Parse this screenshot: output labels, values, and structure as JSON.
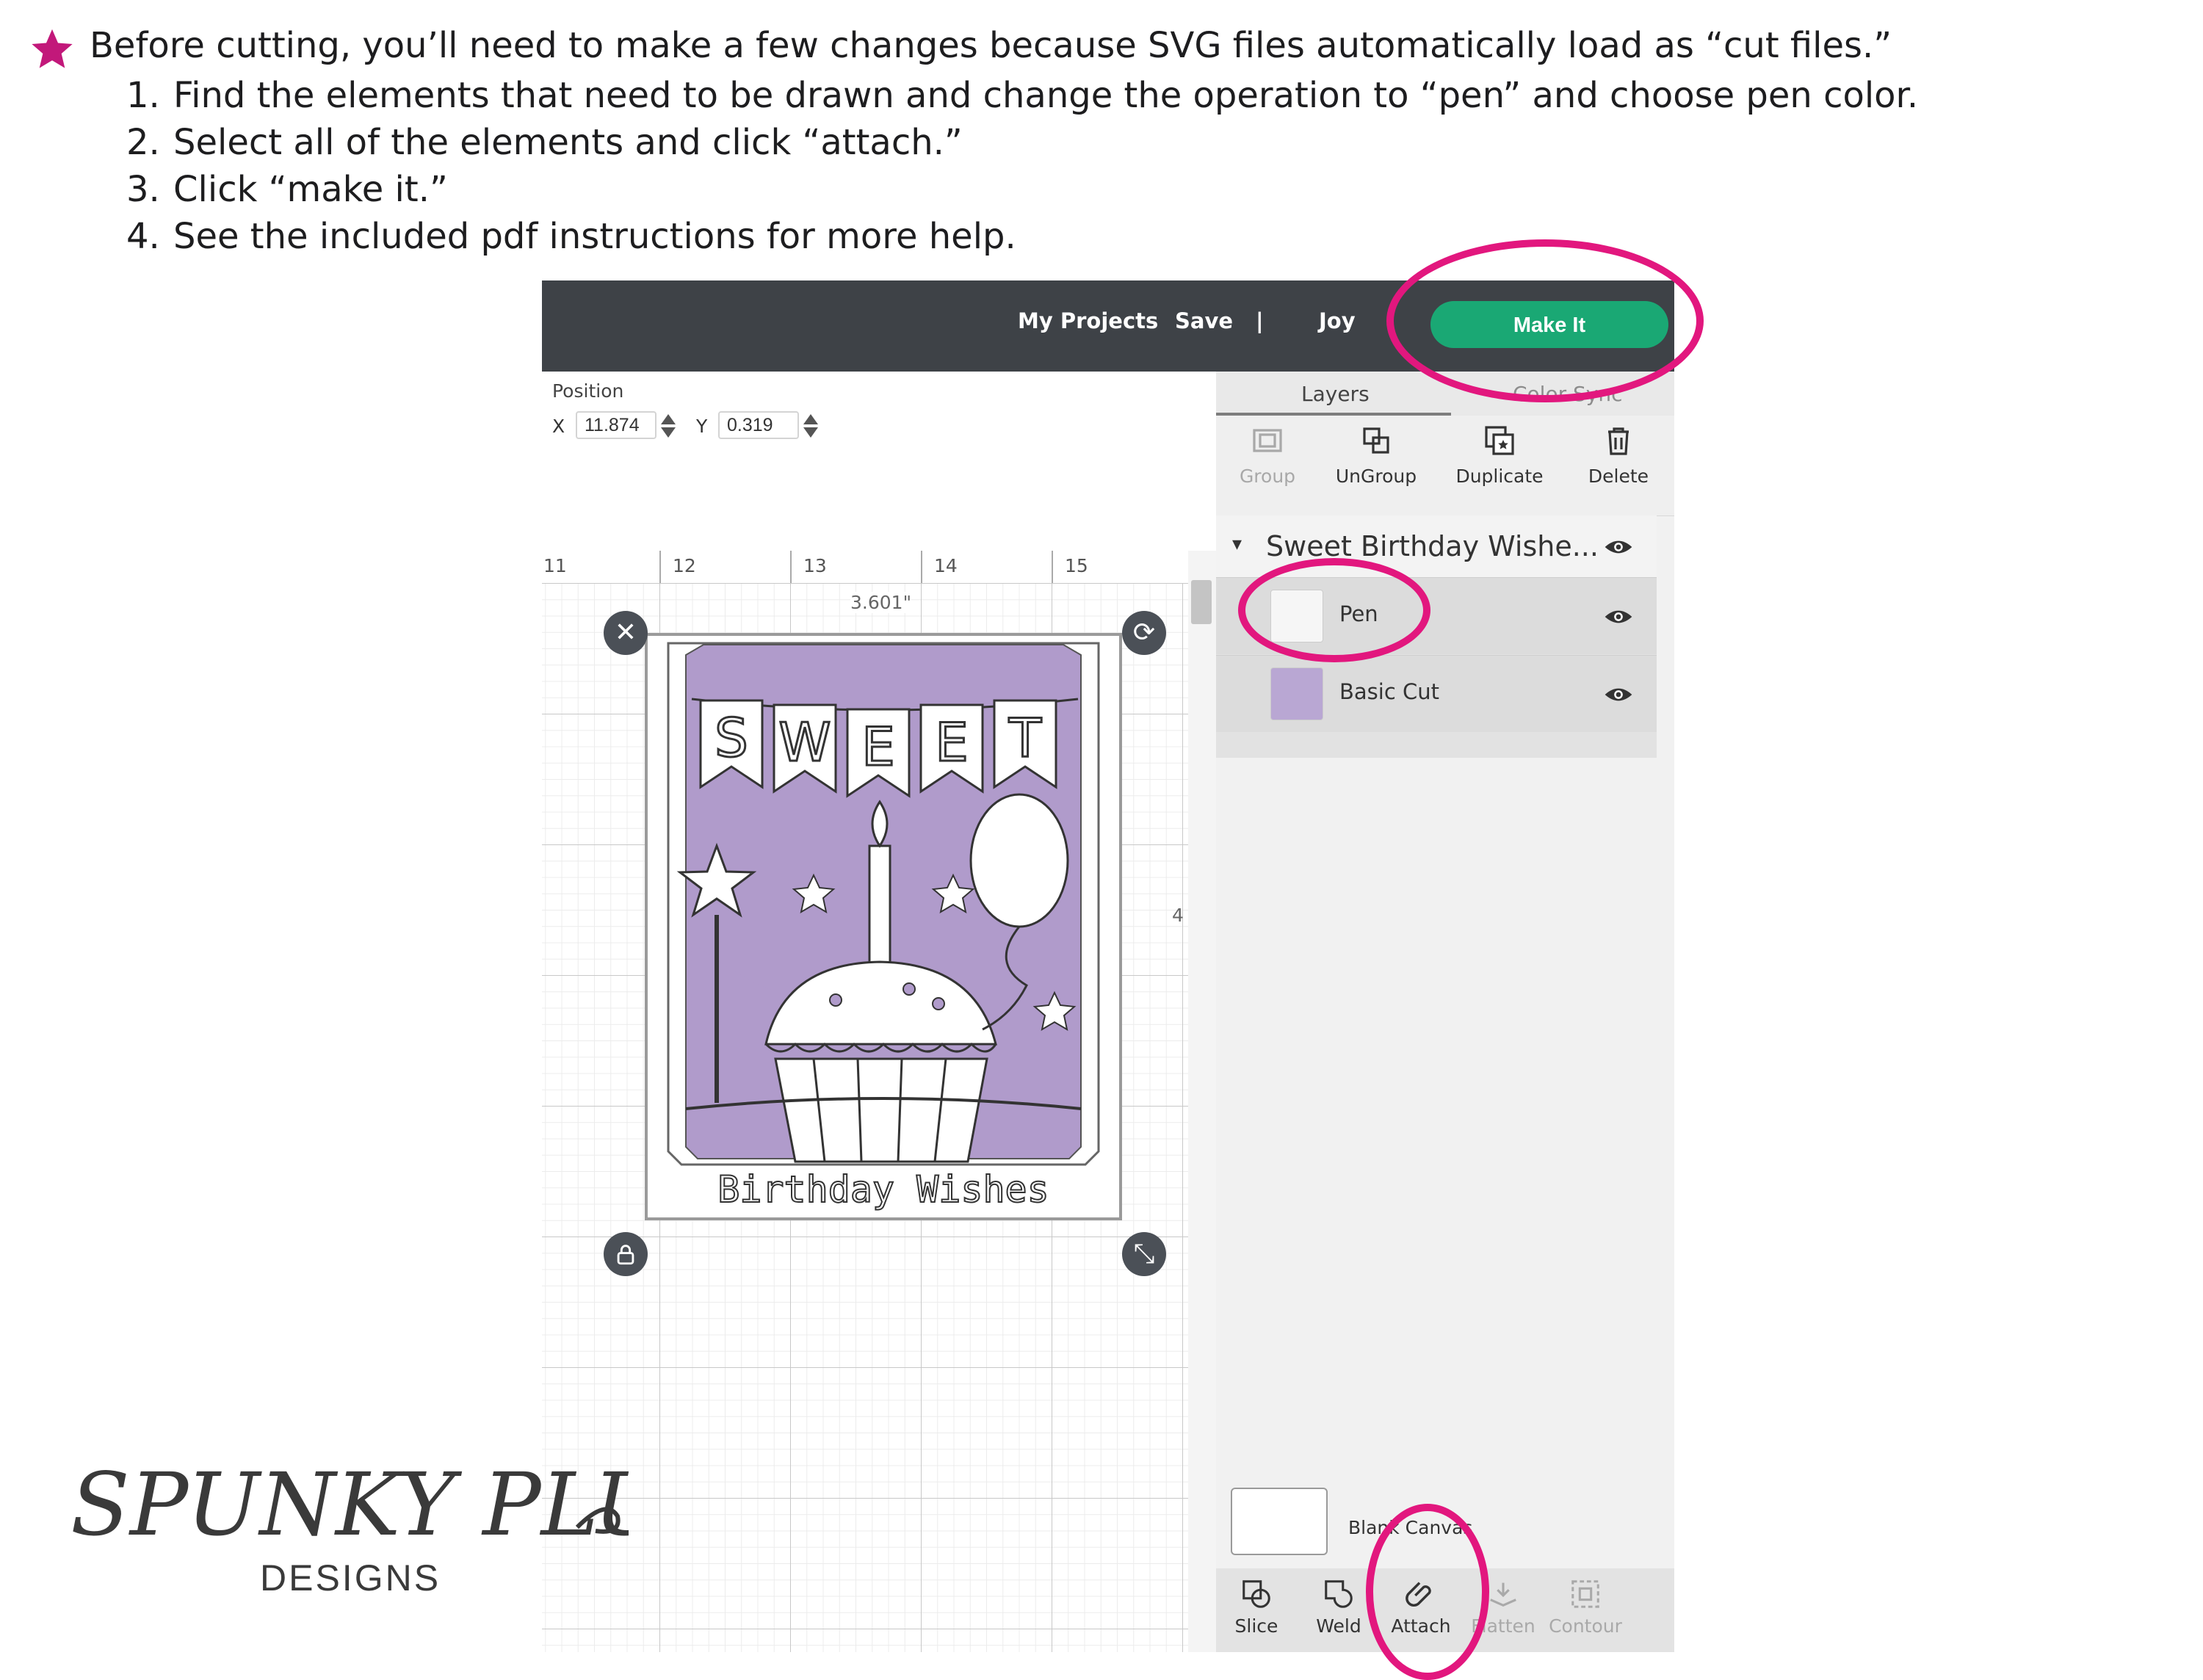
{
  "instructions": {
    "intro": "Before cutting, you’ll need to make  a few changes because SVG files automatically load as “cut files.”",
    "steps": [
      {
        "num": "1.",
        "text": "Find the elements that need to be drawn and change the operation to “pen” and choose pen color."
      },
      {
        "num": "2.",
        "text": "Select all of the elements and click “attach.”"
      },
      {
        "num": "3.",
        "text": "Click “make it.”"
      },
      {
        "num": "4.",
        "text": "See the included pdf instructions  for more help."
      }
    ],
    "bullet_color": "#c2187a"
  },
  "topbar": {
    "my_projects": "My Projects",
    "save": "Save",
    "divider": "|",
    "machine": "Joy",
    "make_it": "Make It"
  },
  "position": {
    "label": "Position",
    "x_label": "X",
    "x_value": "11.874",
    "y_label": "Y",
    "y_value": "0.319"
  },
  "ruler": {
    "ticks": [
      "11",
      "12",
      "13",
      "14",
      "15"
    ],
    "width_readout": "3.601\"",
    "height_readout": "4"
  },
  "design": {
    "banner_letters": [
      "S",
      "W",
      "E",
      "E",
      "T"
    ],
    "caption": "Birthday Wishes",
    "fill_color": "#b09bcb"
  },
  "panel": {
    "tab_layers": "Layers",
    "tab_color_sync": "Color Sync",
    "tools": {
      "group": "Group",
      "ungroup": "UnGroup",
      "duplicate": "Duplicate",
      "delete": "Delete"
    },
    "group_name": "Sweet Birthday Wishe...",
    "layers": [
      {
        "name": "Pen"
      },
      {
        "name": "Basic Cut"
      }
    ],
    "canvas_label": "Blank Canvas",
    "bottom_tools": {
      "slice": "Slice",
      "weld": "Weld",
      "attach": "Attach",
      "flatten": "Flatten",
      "contour": "Contour"
    }
  },
  "brand": {
    "name": "SPUNKY PLUM",
    "subtitle": "DESIGNS"
  },
  "colors": {
    "highlight": "#e2177e",
    "make_it_green": "#1aa874",
    "topbar": "#3e4247"
  }
}
